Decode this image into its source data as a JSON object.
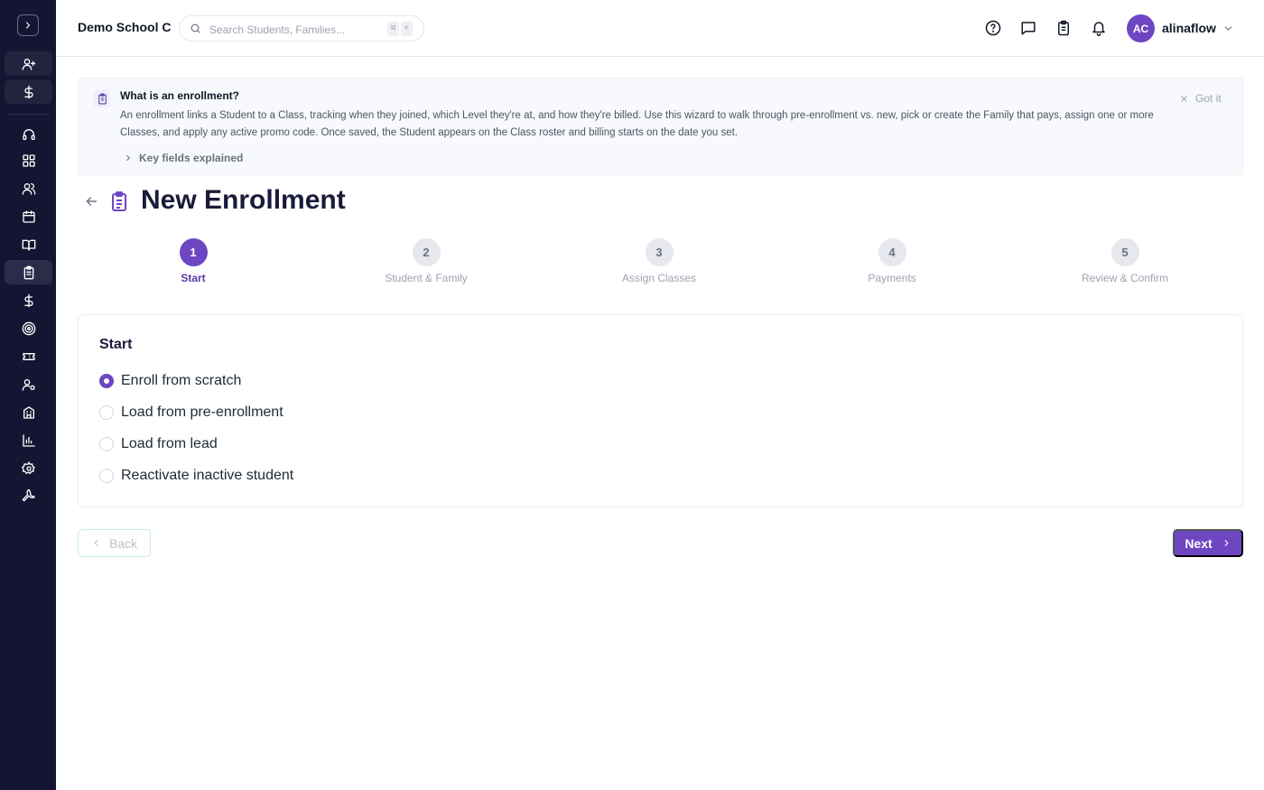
{
  "sidebar": {
    "toggle_icon": "chevron-right-icon",
    "items": [
      {
        "icon": "user-plus-icon"
      },
      {
        "icon": "dollar-icon"
      },
      {
        "icon": "headset-icon"
      },
      {
        "icon": "dashboard-icon"
      },
      {
        "icon": "users-icon"
      },
      {
        "icon": "calendar-icon"
      },
      {
        "icon": "book-icon"
      },
      {
        "icon": "clipboard-icon"
      },
      {
        "icon": "dollar-icon"
      },
      {
        "icon": "target-icon"
      },
      {
        "icon": "ticket-icon"
      },
      {
        "icon": "user-gear-icon"
      },
      {
        "icon": "building-icon"
      },
      {
        "icon": "bar-chart-icon"
      },
      {
        "icon": "gear-icon"
      },
      {
        "icon": "wrench-icon"
      }
    ]
  },
  "header": {
    "school_name": "Demo School C",
    "search_placeholder": "Search Students, Families...",
    "kbd_keys": [
      "⌘",
      "K"
    ],
    "username": "alinaflow",
    "avatar_initials": "AC"
  },
  "banner": {
    "title": "What is an enrollment?",
    "text": "An enrollment links a Student to a Class, tracking when they joined, which Level they're at, and how they're billed. Use this wizard to walk through pre-enrollment vs. new, pick or create the Family that pays, assign one or more Classes, and apply any active promo code. Once saved, the Student appears on the Class roster and billing starts on the date you set.",
    "dismiss_label": "Got it",
    "key_fields_label": "Key fields explained"
  },
  "page": {
    "title": "New Enrollment"
  },
  "stepper": {
    "active_index": 0,
    "steps": [
      {
        "number": "1",
        "label": "Start"
      },
      {
        "number": "2",
        "label": "Student & Family"
      },
      {
        "number": "3",
        "label": "Assign Classes"
      },
      {
        "number": "4",
        "label": "Payments"
      },
      {
        "number": "5",
        "label": "Review & Confirm"
      }
    ]
  },
  "start_card": {
    "title": "Start",
    "selected_index": 0,
    "options": [
      "Enroll from scratch",
      "Load from pre-enrollment",
      "Load from lead",
      "Reactivate inactive student"
    ]
  },
  "actions": {
    "back_label": "Back",
    "next_label": "Next"
  },
  "colors": {
    "sidebar_bg": "#141532",
    "accent": "#6e46c2"
  }
}
